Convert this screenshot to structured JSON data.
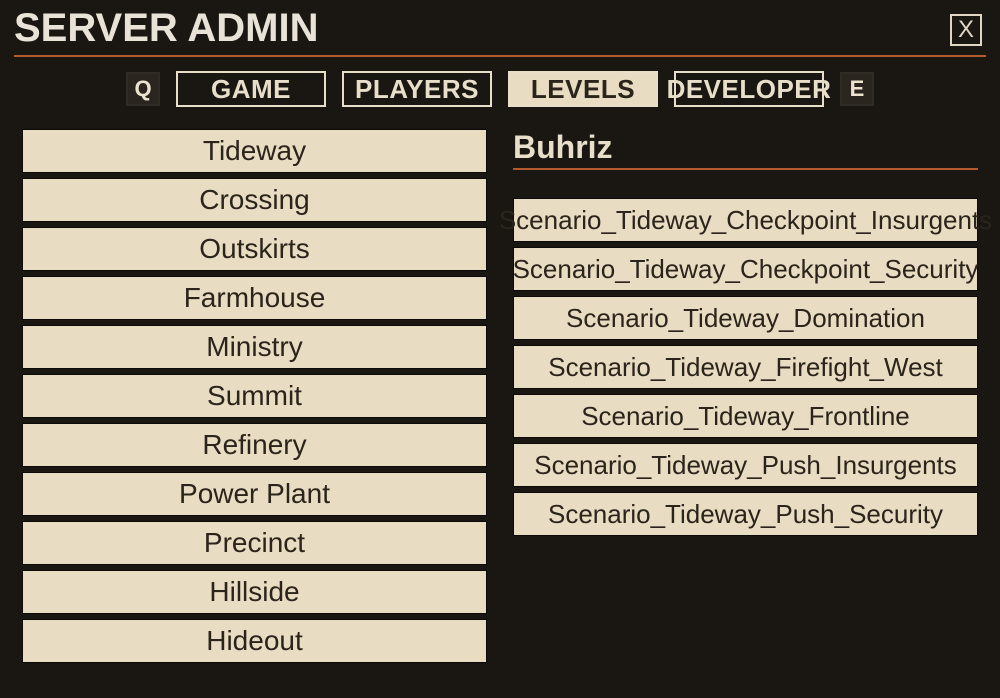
{
  "window": {
    "title": "SERVER ADMIN",
    "close_label": "X",
    "key_prev": "Q",
    "key_next": "E"
  },
  "tabs": [
    {
      "label": "GAME",
      "selected": false
    },
    {
      "label": "PLAYERS",
      "selected": false
    },
    {
      "label": "LEVELS",
      "selected": true
    },
    {
      "label": "DEVELOPER",
      "selected": false
    }
  ],
  "levels": [
    "Tideway",
    "Crossing",
    "Outskirts",
    "Farmhouse",
    "Ministry",
    "Summit",
    "Refinery",
    "Power Plant",
    "Precinct",
    "Hillside",
    "Hideout"
  ],
  "detail": {
    "title": "Buhriz",
    "scenarios": [
      "Scenario_Tideway_Checkpoint_Insurgents",
      "Scenario_Tideway_Checkpoint_Security",
      "Scenario_Tideway_Domination",
      "Scenario_Tideway_Firefight_West",
      "Scenario_Tideway_Frontline",
      "Scenario_Tideway_Push_Insurgents",
      "Scenario_Tideway_Push_Security"
    ]
  }
}
